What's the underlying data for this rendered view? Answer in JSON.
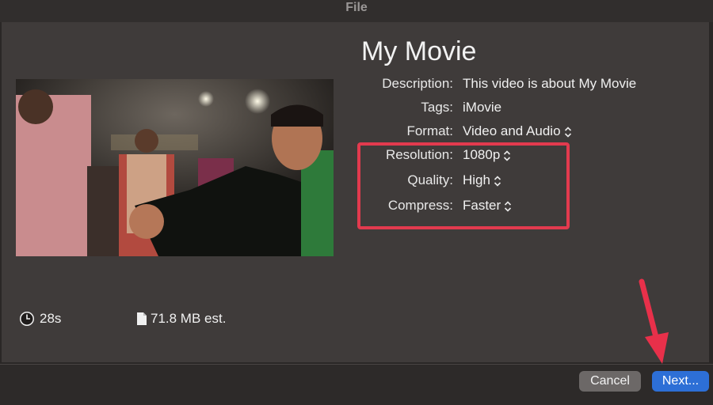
{
  "window": {
    "title": "File"
  },
  "movie": {
    "title": "My Movie"
  },
  "fields": [
    {
      "label": "Description:",
      "value": "This video is about My Movie",
      "has_stepper": false
    },
    {
      "label": "Tags:",
      "value": "iMovie",
      "has_stepper": false
    },
    {
      "label": "Format:",
      "value": "Video and Audio",
      "has_stepper": true
    },
    {
      "label": "Resolution:",
      "value": "1080p",
      "has_stepper": true
    },
    {
      "label": "Quality:",
      "value": "High",
      "has_stepper": true
    },
    {
      "label": "Compress:",
      "value": "Faster",
      "has_stepper": true
    }
  ],
  "stats": {
    "duration": "28s",
    "duration_icon": "clock-icon",
    "size": "71.8 MB est.",
    "size_icon": "document-icon"
  },
  "buttons": {
    "cancel": "Cancel",
    "next": "Next..."
  },
  "colors": {
    "highlight": "#e23a4e",
    "arrow": "#e8304a",
    "primary_button": "#2d6fd6",
    "panel": "#3f3b3a"
  }
}
